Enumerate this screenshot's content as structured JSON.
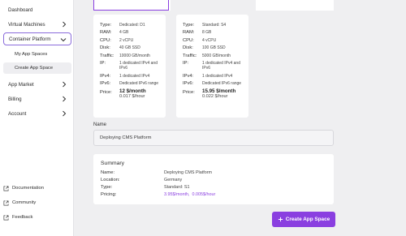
{
  "sidebar": {
    "items": [
      {
        "label": "Dashboard"
      },
      {
        "label": "Virtual Machines"
      },
      {
        "label": "Container Platform"
      },
      {
        "label": "My App Spaces"
      },
      {
        "label": "Create App Space"
      },
      {
        "label": "App Market"
      },
      {
        "label": "Billing"
      },
      {
        "label": "Account"
      }
    ],
    "footer": [
      {
        "label": "Documentation",
        "icon": "external-link-icon"
      },
      {
        "label": "Community",
        "icon": "external-link-icon"
      },
      {
        "label": "Feedback",
        "icon": "external-link-icon"
      }
    ]
  },
  "plans": [
    {
      "type": "Dedicated: D1",
      "ram": "4 GB",
      "cpu": "2 vCPU",
      "disk": "40 GB SSD",
      "traffic": "10000 GB/month",
      "ip": "1 dedicated IPv4 and IPv6",
      "ipv4": "1 dedicated IPv4",
      "ipv6": "Dedicated IPv6 range",
      "price_month": "12 $/month",
      "price_hour": "0.017 $/hour"
    },
    {
      "type": "Standard: S4",
      "ram": "8 GB",
      "cpu": "4 vCPU",
      "disk": "100 GB SSD",
      "traffic": "5000 GB/month",
      "ip": "1 dedicated IPv4 and IPv6",
      "ipv4": "1 dedicated IPv4",
      "ipv6": "Dedicated IPv6 range",
      "price_month": "15.95 $/month",
      "price_hour": "0.022 $/hour"
    }
  ],
  "labels": {
    "type": "Type:",
    "ram": "RAM:",
    "cpu": "CPU:",
    "disk": "Disk:",
    "traffic": "Traffic:",
    "ip": "IP:",
    "ipv4": "IPv4:",
    "ipv6": "IPv6:",
    "price": "Price:"
  },
  "name_field": {
    "label": "Name",
    "value": "Deploying CMS Platform"
  },
  "summary": {
    "title": "Summary",
    "name_label": "Name:",
    "name_value": "Deploying CMS Platform",
    "location_label": "Location:",
    "location_value": "Germany",
    "type_label": "Type:",
    "type_value": "Standard:  S1",
    "pricing_label": "Pricing:",
    "pricing_month": "3.95$/month,",
    "pricing_hour": "0.005$/hour"
  },
  "create_button": {
    "label": "Create App Space",
    "icon": "plus-icon"
  },
  "colors": {
    "accent": "#8a3fe0",
    "active_border": "#8a6cdb",
    "background": "#efeff1"
  }
}
